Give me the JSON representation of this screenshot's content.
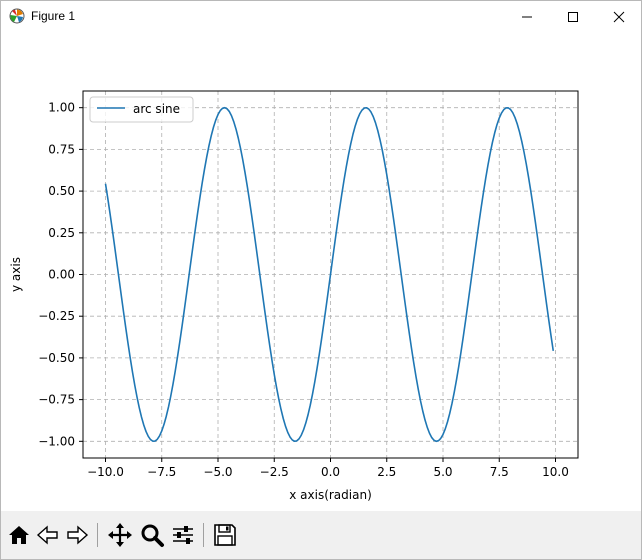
{
  "window": {
    "title": "Figure 1",
    "minimize_icon": "minimize-icon",
    "maximize_icon": "maximize-icon",
    "close_icon": "close-icon"
  },
  "toolbar": {
    "buttons": [
      {
        "icon": "home-icon",
        "tooltip": "Home"
      },
      {
        "icon": "back-arrow-icon",
        "tooltip": "Back"
      },
      {
        "icon": "forward-arrow-icon",
        "tooltip": "Forward"
      },
      {
        "icon": "pan-move-icon",
        "tooltip": "Pan"
      },
      {
        "icon": "zoom-magnifier-icon",
        "tooltip": "Zoom"
      },
      {
        "icon": "configure-subplots-icon",
        "tooltip": "Subplots"
      },
      {
        "icon": "save-floppy-icon",
        "tooltip": "Save"
      }
    ]
  },
  "chart_data": {
    "type": "line",
    "title": "",
    "xlabel": "x axis(radian)",
    "ylabel": "y axis",
    "xlim": [
      -11.0,
      11.0
    ],
    "ylim": [
      -1.1,
      1.1
    ],
    "x_ticks": [
      -10.0,
      -7.5,
      -5.0,
      -2.5,
      0.0,
      2.5,
      5.0,
      7.5,
      10.0
    ],
    "x_tick_labels": [
      "−10.0",
      "−7.5",
      "−5.0",
      "−2.5",
      "0.0",
      "2.5",
      "5.0",
      "7.5",
      "10.0"
    ],
    "y_ticks": [
      1.0,
      0.75,
      0.5,
      0.25,
      0.0,
      -0.25,
      -0.5,
      -0.75,
      -1.0
    ],
    "y_tick_labels": [
      "1.00",
      "0.75",
      "0.50",
      "0.25",
      "0.00",
      "−0.25",
      "−0.50",
      "−0.75",
      "−1.00"
    ],
    "grid": true,
    "grid_style": "dashed",
    "legend_position": "upper-left",
    "series": [
      {
        "name": "arc sine",
        "color": "#1f77b4",
        "function": "sin(x)",
        "x_start": -10.0,
        "x_end": 9.9,
        "x_step": 0.1
      }
    ]
  }
}
